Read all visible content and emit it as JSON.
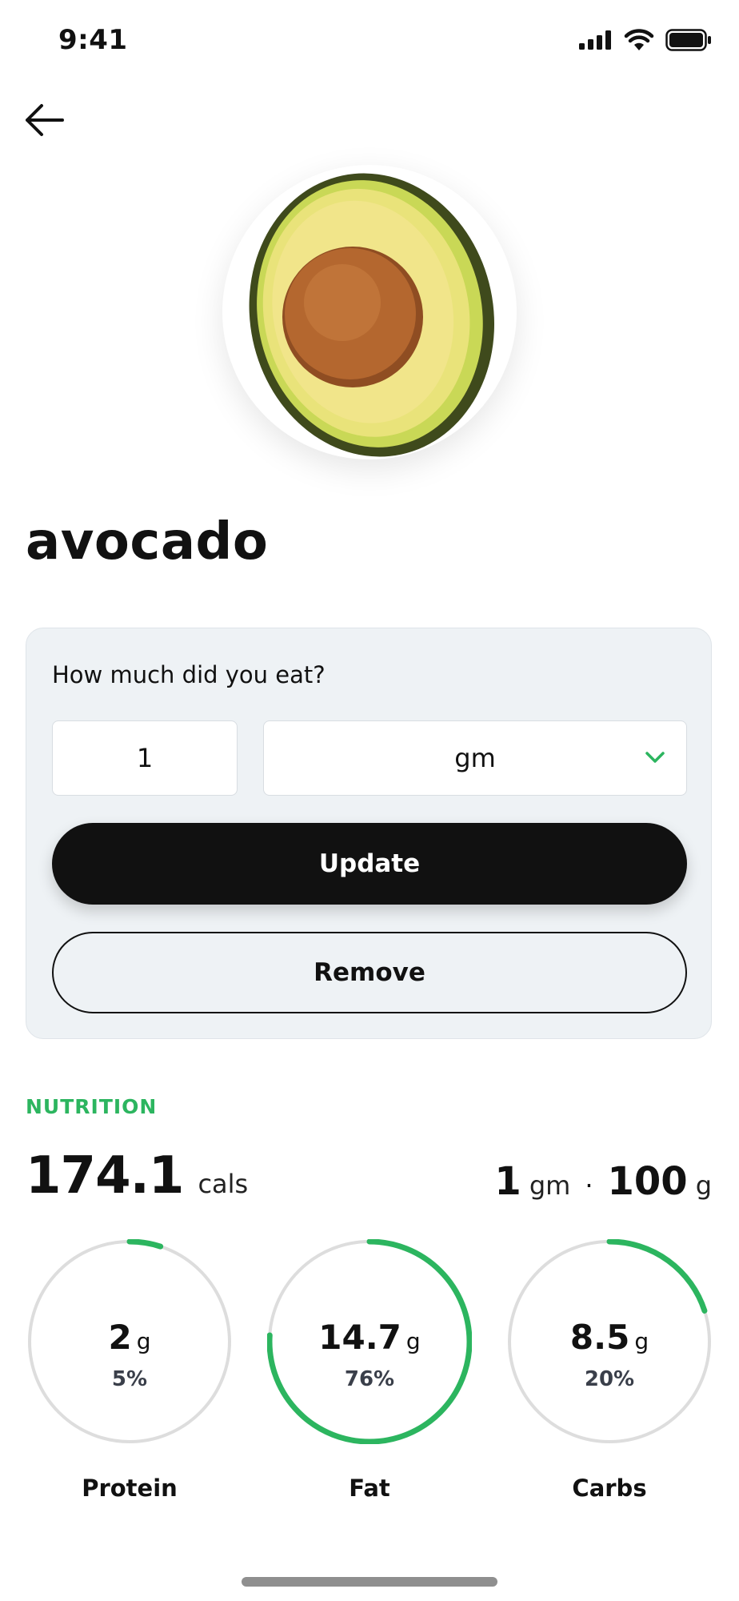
{
  "status_bar": {
    "time": "9:41"
  },
  "food": {
    "name": "avocado"
  },
  "portion": {
    "question": "How much did you eat?",
    "quantity": "1",
    "unit": "gm",
    "update_label": "Update",
    "remove_label": "Remove"
  },
  "nutrition": {
    "section_label": "NUTRITION",
    "calories": "174.1",
    "calories_unit": "cals",
    "serving_qty": "1",
    "serving_unit": "gm",
    "serving_dot": "·",
    "serving_weight": "100",
    "serving_weight_unit": "g",
    "macros": [
      {
        "name": "Protein",
        "amount": "2",
        "unit": "g",
        "percent": "5%",
        "fraction": 0.05
      },
      {
        "name": "Fat",
        "amount": "14.7",
        "unit": "g",
        "percent": "76%",
        "fraction": 0.76
      },
      {
        "name": "Carbs",
        "amount": "8.5",
        "unit": "g",
        "percent": "20%",
        "fraction": 0.2
      }
    ]
  },
  "colors": {
    "accent": "#2cb55f",
    "ring_track": "#dddddd",
    "primary_button": "#111111"
  },
  "icons": {
    "back": "arrow-left-icon",
    "signal": "cellular-signal-icon",
    "wifi": "wifi-icon",
    "battery": "battery-icon",
    "chevron": "chevron-down-icon"
  }
}
